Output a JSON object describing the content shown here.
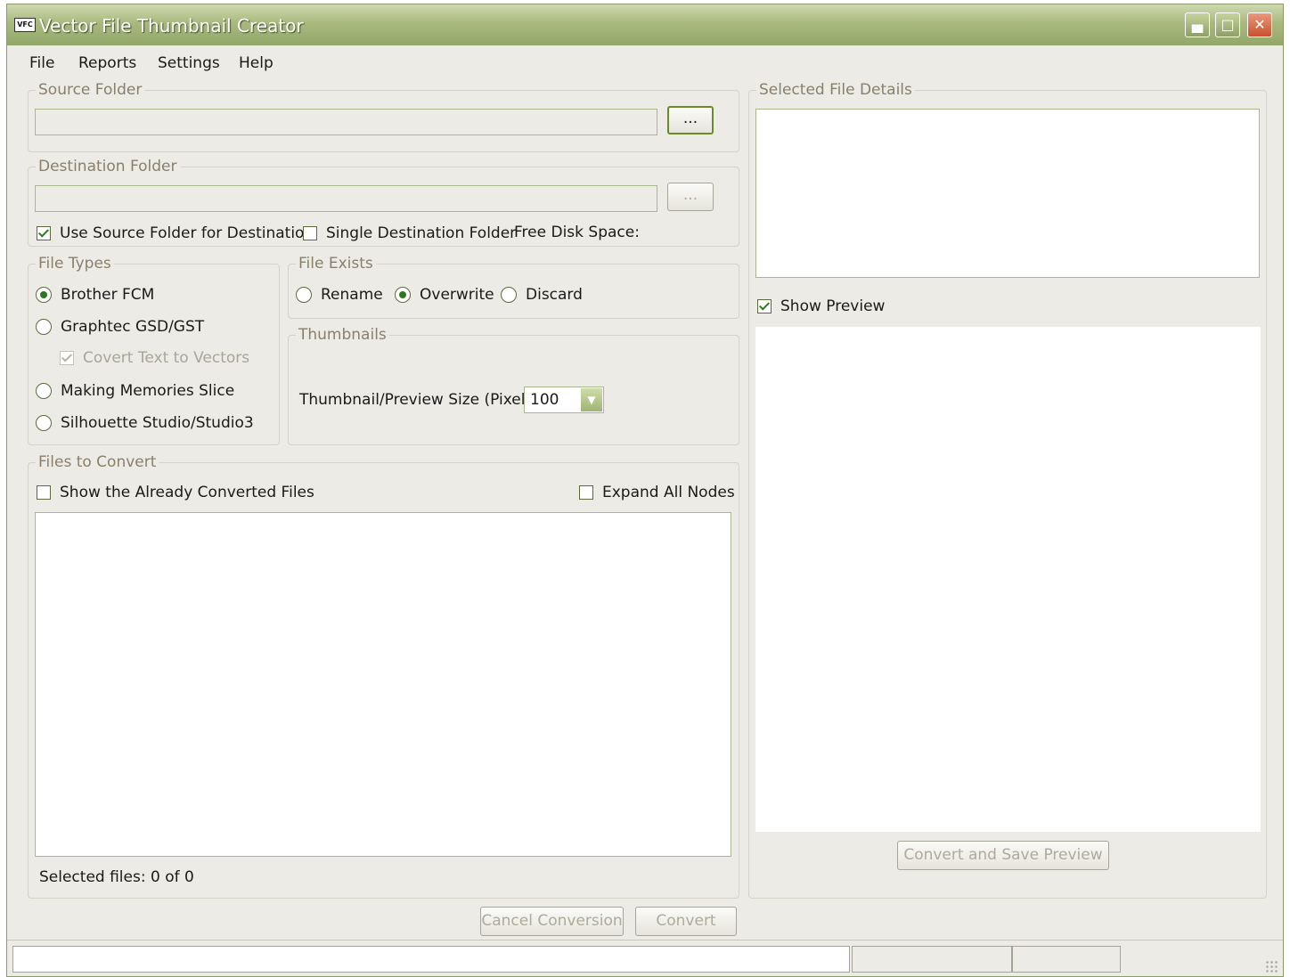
{
  "window": {
    "icon_text": "VFC",
    "title": "Vector File Thumbnail Creator"
  },
  "menu": [
    "File",
    "Reports",
    "Settings",
    "Help"
  ],
  "source_folder": {
    "legend": "Source Folder",
    "path_value": "",
    "browse_label": "..."
  },
  "destination_folder": {
    "legend": "Destination Folder",
    "path_value": "",
    "browse_label": "...",
    "use_source_label": "Use Source Folder for Destination",
    "use_source_checked": true,
    "single_dest_label": "Single Destination Folder",
    "single_dest_checked": false,
    "free_space_label": "Free Disk Space:"
  },
  "file_types": {
    "legend": "File Types",
    "options": [
      "Brother FCM",
      "Graphtec GSD/GST",
      "Making Memories Slice",
      "Silhouette Studio/Studio3"
    ],
    "selected": "Brother FCM",
    "convert_text_label": "Covert Text to Vectors",
    "convert_text_checked": true
  },
  "file_exists": {
    "legend": "File Exists",
    "options": [
      "Rename",
      "Overwrite",
      "Discard"
    ],
    "selected": "Overwrite"
  },
  "thumbnails": {
    "legend": "Thumbnails",
    "size_label": "Thumbnail/Preview Size (Pixels)",
    "size_value": "100"
  },
  "files_to_convert": {
    "legend": "Files to Convert",
    "show_converted_label": "Show the Already Converted Files",
    "show_converted_checked": false,
    "expand_nodes_label": "Expand All Nodes",
    "expand_nodes_checked": false,
    "selected_files_text": "Selected files: 0 of 0"
  },
  "actions": {
    "cancel_label": "Cancel Conversion",
    "convert_label": "Convert"
  },
  "selected_file_details": {
    "legend": "Selected File Details",
    "show_preview_label": "Show Preview",
    "show_preview_checked": true,
    "convert_save_label": "Convert and Save Preview"
  },
  "colors": {
    "accent": "#2c7a1e",
    "titlebar": "#a8b97e",
    "window_bg": "#ecebe5",
    "group_legend": "#8a7f6b"
  }
}
